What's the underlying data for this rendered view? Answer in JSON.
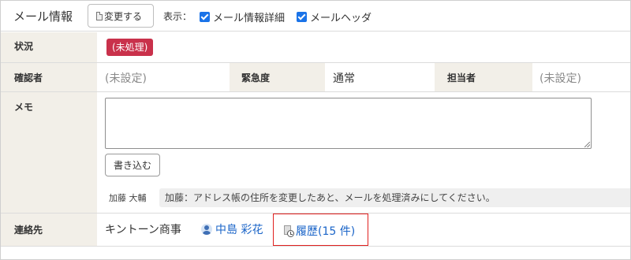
{
  "header": {
    "title": "メール情報",
    "change_button": "変更する",
    "display_label": "表示：",
    "checkbox_detail": "メール情報詳細",
    "checkbox_header": "メールヘッダ"
  },
  "status": {
    "label": "状況",
    "value": "(未処理)",
    "badge_color": "#c9314b"
  },
  "confirm": {
    "label": "確認者",
    "value": "(未設定)",
    "urgency_label": "緊急度",
    "urgency_value": "通常",
    "assignee_label": "担当者",
    "assignee_value": "(未設定)"
  },
  "memo": {
    "label": "メモ",
    "textarea_value": "",
    "write_button": "書き込む",
    "author": "加藤 大輔",
    "comment": "加藤：アドレス帳の住所を変更したあと、メールを処理済みにしてください。"
  },
  "contact": {
    "label": "連絡先",
    "company": "キントーン商事",
    "person": "中島 彩花",
    "history_link": "履歴(15 件)",
    "link_color": "#1a64c8",
    "highlight_color": "#e0201f"
  }
}
